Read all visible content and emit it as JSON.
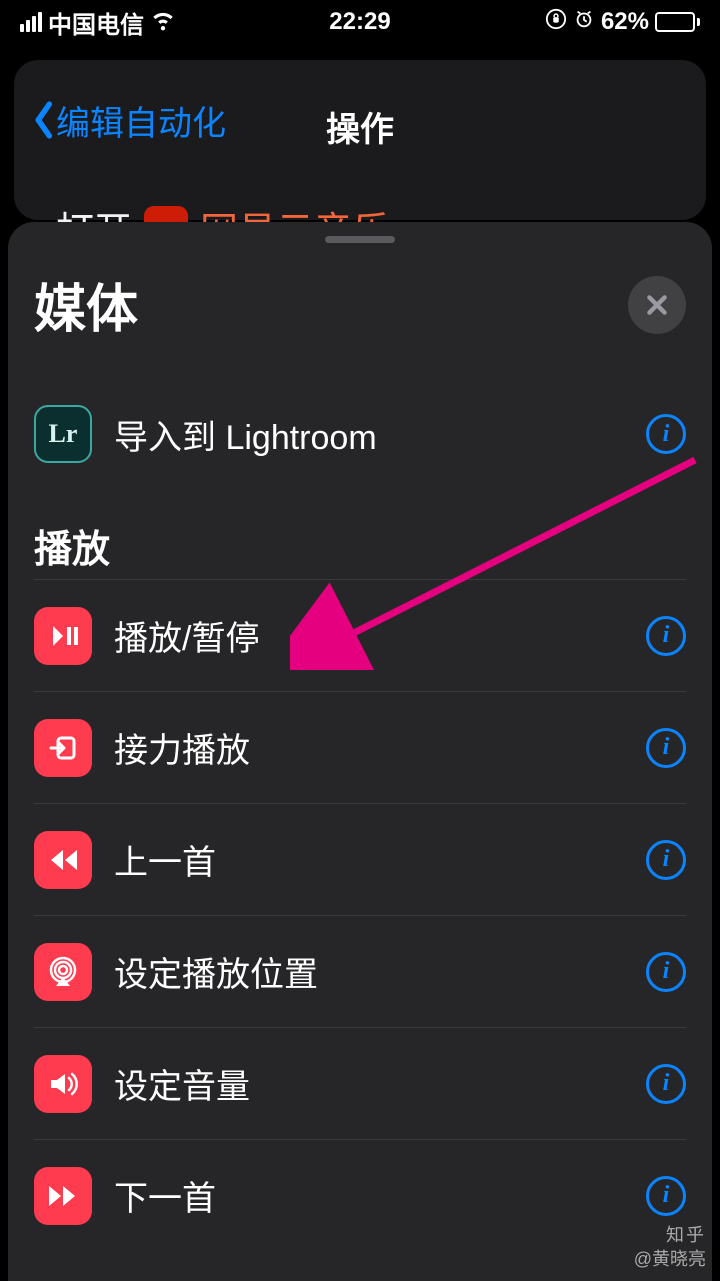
{
  "status": {
    "carrier": "中国电信",
    "time": "22:29",
    "battery_pct": "62%"
  },
  "nav": {
    "back_label": "编辑自动化",
    "title": "操作",
    "peek_open": "打开",
    "peek_app": "网易云音乐"
  },
  "sheet": {
    "title": "媒体"
  },
  "apps": {
    "lightroom": {
      "label": "导入到 Lightroom",
      "badge": "Lr"
    }
  },
  "section_playback": "播放",
  "items": {
    "play_pause": "播放/暂停",
    "handoff": "接力播放",
    "previous": "上一首",
    "set_dest": "设定播放位置",
    "set_volume": "设定音量",
    "next": "下一首"
  },
  "watermark": {
    "brand": "知乎",
    "author": "@黄晓亮"
  }
}
